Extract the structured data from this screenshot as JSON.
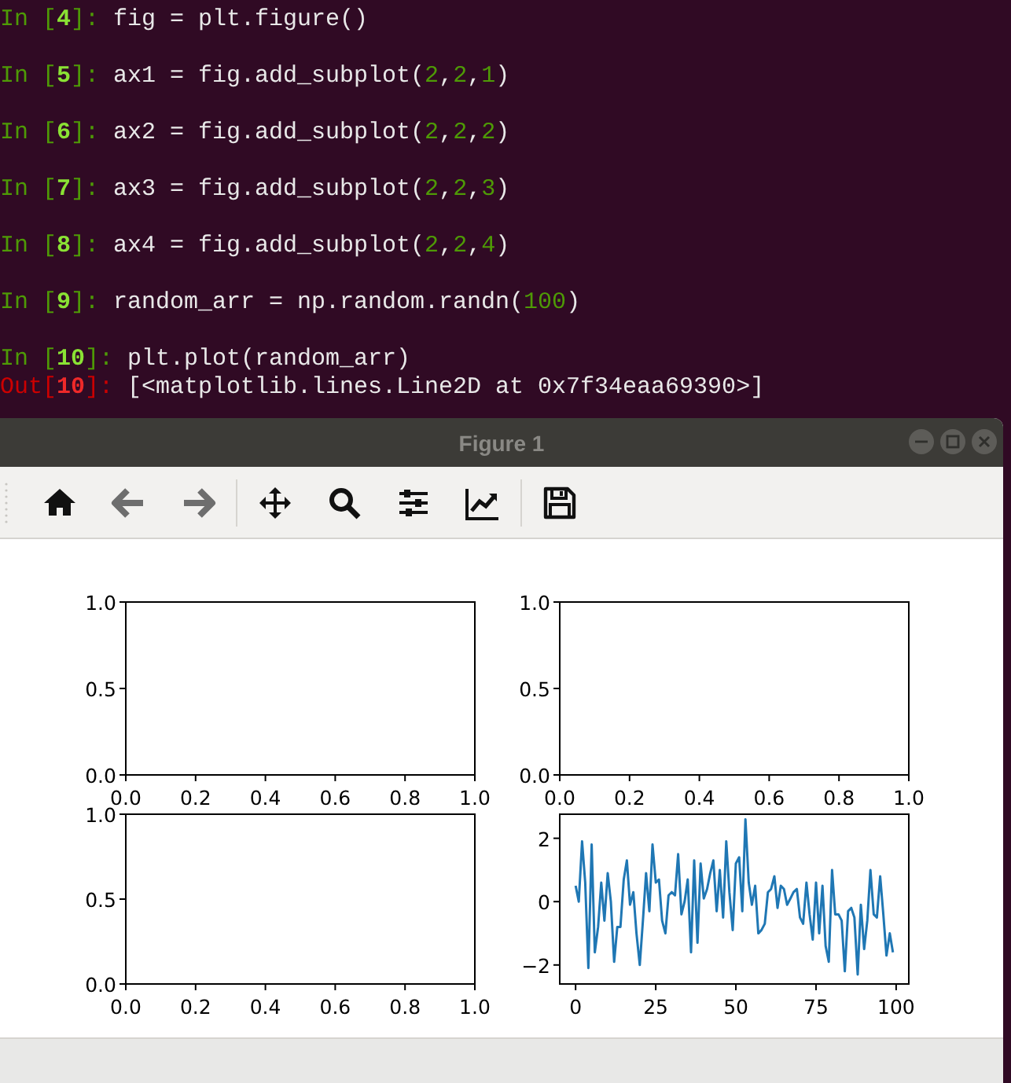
{
  "terminal": {
    "lines": [
      {
        "kind": "in",
        "prompt": "In [",
        "number": "4",
        "prompt_end": "]:",
        "tokens": [
          {
            "kind": "plain",
            "text": "fig = plt.figure()"
          }
        ]
      },
      {
        "kind": "in",
        "prompt": "In [",
        "number": "5",
        "prompt_end": "]:",
        "tokens": [
          {
            "kind": "plain",
            "text": "ax1 = fig.add_subplot("
          },
          {
            "kind": "number",
            "text": "2"
          },
          {
            "kind": "plain",
            "text": ","
          },
          {
            "kind": "number",
            "text": "2"
          },
          {
            "kind": "plain",
            "text": ","
          },
          {
            "kind": "number",
            "text": "1"
          },
          {
            "kind": "plain",
            "text": ")"
          }
        ]
      },
      {
        "kind": "in",
        "prompt": "In [",
        "number": "6",
        "prompt_end": "]:",
        "tokens": [
          {
            "kind": "plain",
            "text": "ax2 = fig.add_subplot("
          },
          {
            "kind": "number",
            "text": "2"
          },
          {
            "kind": "plain",
            "text": ","
          },
          {
            "kind": "number",
            "text": "2"
          },
          {
            "kind": "plain",
            "text": ","
          },
          {
            "kind": "number",
            "text": "2"
          },
          {
            "kind": "plain",
            "text": ")"
          }
        ]
      },
      {
        "kind": "in",
        "prompt": "In [",
        "number": "7",
        "prompt_end": "]:",
        "tokens": [
          {
            "kind": "plain",
            "text": "ax3 = fig.add_subplot("
          },
          {
            "kind": "number",
            "text": "2"
          },
          {
            "kind": "plain",
            "text": ","
          },
          {
            "kind": "number",
            "text": "2"
          },
          {
            "kind": "plain",
            "text": ","
          },
          {
            "kind": "number",
            "text": "3"
          },
          {
            "kind": "plain",
            "text": ")"
          }
        ]
      },
      {
        "kind": "in",
        "prompt": "In [",
        "number": "8",
        "prompt_end": "]:",
        "tokens": [
          {
            "kind": "plain",
            "text": "ax4 = fig.add_subplot("
          },
          {
            "kind": "number",
            "text": "2"
          },
          {
            "kind": "plain",
            "text": ","
          },
          {
            "kind": "number",
            "text": "2"
          },
          {
            "kind": "plain",
            "text": ","
          },
          {
            "kind": "number",
            "text": "4"
          },
          {
            "kind": "plain",
            "text": ")"
          }
        ]
      },
      {
        "kind": "in",
        "prompt": "In [",
        "number": "9",
        "prompt_end": "]:",
        "tokens": [
          {
            "kind": "plain",
            "text": "random_arr = np.random.randn("
          },
          {
            "kind": "number",
            "text": "100"
          },
          {
            "kind": "plain",
            "text": ")"
          }
        ]
      },
      {
        "kind": "in",
        "prompt": "In [",
        "number": "10",
        "prompt_end": "]:",
        "tokens": [
          {
            "kind": "plain",
            "text": "plt.plot(random_arr)"
          }
        ]
      },
      {
        "kind": "out",
        "prompt": "Out[",
        "number": "10",
        "prompt_end": "]:",
        "tokens": [
          {
            "kind": "plain",
            "text": "[<matplotlib.lines.Line2D at 0x7f34eaa69390>]"
          }
        ]
      }
    ]
  },
  "window": {
    "title": "Figure 1"
  },
  "toolbar": {
    "buttons": [
      {
        "kind": "home",
        "disabled": false
      },
      {
        "kind": "back",
        "disabled": true
      },
      {
        "kind": "forward",
        "disabled": true
      },
      {
        "kind": "separator"
      },
      {
        "kind": "pan",
        "disabled": false
      },
      {
        "kind": "zoom",
        "disabled": false
      },
      {
        "kind": "subplots",
        "disabled": false
      },
      {
        "kind": "axes",
        "disabled": false
      },
      {
        "kind": "separator"
      },
      {
        "kind": "save",
        "disabled": false
      }
    ]
  },
  "figure": {
    "subplots": [
      {
        "chart_data": {
          "type": "line",
          "xlim": [
            0,
            1
          ],
          "ylim": [
            0,
            1
          ],
          "xticks": [
            {
              "value": 0,
              "label": "0.0"
            },
            {
              "value": 0.2,
              "label": "0.2"
            },
            {
              "value": 0.4,
              "label": "0.4"
            },
            {
              "value": 0.6,
              "label": "0.6"
            },
            {
              "value": 0.8,
              "label": "0.8"
            },
            {
              "value": 1,
              "label": "1.0"
            }
          ],
          "yticks": [
            {
              "value": 0,
              "label": "0.0"
            },
            {
              "value": 0.5,
              "label": "0.5"
            },
            {
              "value": 1,
              "label": "1.0"
            }
          ]
        }
      },
      {
        "chart_data": {
          "type": "line",
          "xlim": [
            0,
            1
          ],
          "ylim": [
            0,
            1
          ],
          "xticks": [
            {
              "value": 0,
              "label": "0.0"
            },
            {
              "value": 0.2,
              "label": "0.2"
            },
            {
              "value": 0.4,
              "label": "0.4"
            },
            {
              "value": 0.6,
              "label": "0.6"
            },
            {
              "value": 0.8,
              "label": "0.8"
            },
            {
              "value": 1,
              "label": "1.0"
            }
          ],
          "yticks": [
            {
              "value": 0,
              "label": "0.0"
            },
            {
              "value": 0.5,
              "label": "0.5"
            },
            {
              "value": 1,
              "label": "1.0"
            }
          ]
        }
      },
      {
        "chart_data": {
          "type": "line",
          "xlim": [
            0,
            1
          ],
          "ylim": [
            0,
            1
          ],
          "xticks": [
            {
              "value": 0,
              "label": "0.0"
            },
            {
              "value": 0.2,
              "label": "0.2"
            },
            {
              "value": 0.4,
              "label": "0.4"
            },
            {
              "value": 0.6,
              "label": "0.6"
            },
            {
              "value": 0.8,
              "label": "0.8"
            },
            {
              "value": 1,
              "label": "1.0"
            }
          ],
          "yticks": [
            {
              "value": 0,
              "label": "0.0"
            },
            {
              "value": 0.5,
              "label": "0.5"
            },
            {
              "value": 1,
              "label": "1.0"
            }
          ]
        }
      },
      {
        "chart_data": {
          "type": "line",
          "x": [
            0,
            1,
            2,
            3,
            4,
            5,
            6,
            7,
            8,
            9,
            10,
            11,
            12,
            13,
            14,
            15,
            16,
            17,
            18,
            19,
            20,
            21,
            22,
            23,
            24,
            25,
            26,
            27,
            28,
            29,
            30,
            31,
            32,
            33,
            34,
            35,
            36,
            37,
            38,
            39,
            40,
            41,
            42,
            43,
            44,
            45,
            46,
            47,
            48,
            49,
            50,
            51,
            52,
            53,
            54,
            55,
            56,
            57,
            58,
            59,
            60,
            61,
            62,
            63,
            64,
            65,
            66,
            67,
            68,
            69,
            70,
            71,
            72,
            73,
            74,
            75,
            76,
            77,
            78,
            79,
            80,
            81,
            82,
            83,
            84,
            85,
            86,
            87,
            88,
            89,
            90,
            91,
            92,
            93,
            94,
            95,
            96,
            97,
            98,
            99
          ],
          "xlim": [
            -4.95,
            103.95
          ],
          "ylim": [
            -2.6,
            2.76
          ],
          "xticks": [
            {
              "value": 0,
              "label": "0"
            },
            {
              "value": 25,
              "label": "25"
            },
            {
              "value": 50,
              "label": "50"
            },
            {
              "value": 75,
              "label": "75"
            },
            {
              "value": 100,
              "label": "100"
            }
          ],
          "yticks": [
            {
              "value": -2,
              "label": "−2"
            },
            {
              "value": 0,
              "label": "0"
            },
            {
              "value": 2,
              "label": "2"
            }
          ],
          "series": [
            {
              "color": "#1f77b4",
              "values": [
                0.5,
                0.0,
                1.9,
                0.6,
                -2.1,
                1.8,
                -1.6,
                -0.8,
                0.6,
                -0.6,
                0.9,
                0.0,
                -1.9,
                -0.8,
                -0.8,
                0.7,
                1.3,
                -0.1,
                0.3,
                -1.0,
                -2.0,
                -0.6,
                0.9,
                -0.3,
                1.8,
                0.6,
                0.7,
                -0.6,
                -1.0,
                0.2,
                0.3,
                0.2,
                1.5,
                -0.4,
                0.0,
                0.7,
                -1.6,
                1.3,
                -1.3,
                1.2,
                0.1,
                0.4,
                0.9,
                1.3,
                -0.3,
                1.0,
                -0.5,
                1.9,
                0.3,
                -0.9,
                1.2,
                1.4,
                -0.3,
                2.6,
                0.6,
                -0.1,
                0.5,
                -1.0,
                -0.9,
                -0.7,
                0.3,
                0.4,
                0.8,
                -0.2,
                0.5,
                0.4,
                -0.1,
                0.1,
                0.3,
                0.4,
                -0.5,
                -0.7,
                0.6,
                -0.4,
                -1.2,
                0.6,
                -1.0,
                0.5,
                -1.4,
                -1.9,
                1.0,
                -0.4,
                -0.4,
                -0.6,
                -2.2,
                -0.3,
                -0.2,
                -0.5,
                -2.3,
                -0.1,
                -1.5,
                -0.6,
                1.0,
                -0.4,
                -0.5,
                0.8,
                -0.4,
                -1.7,
                -1.0,
                -1.6
              ]
            }
          ]
        }
      }
    ]
  }
}
